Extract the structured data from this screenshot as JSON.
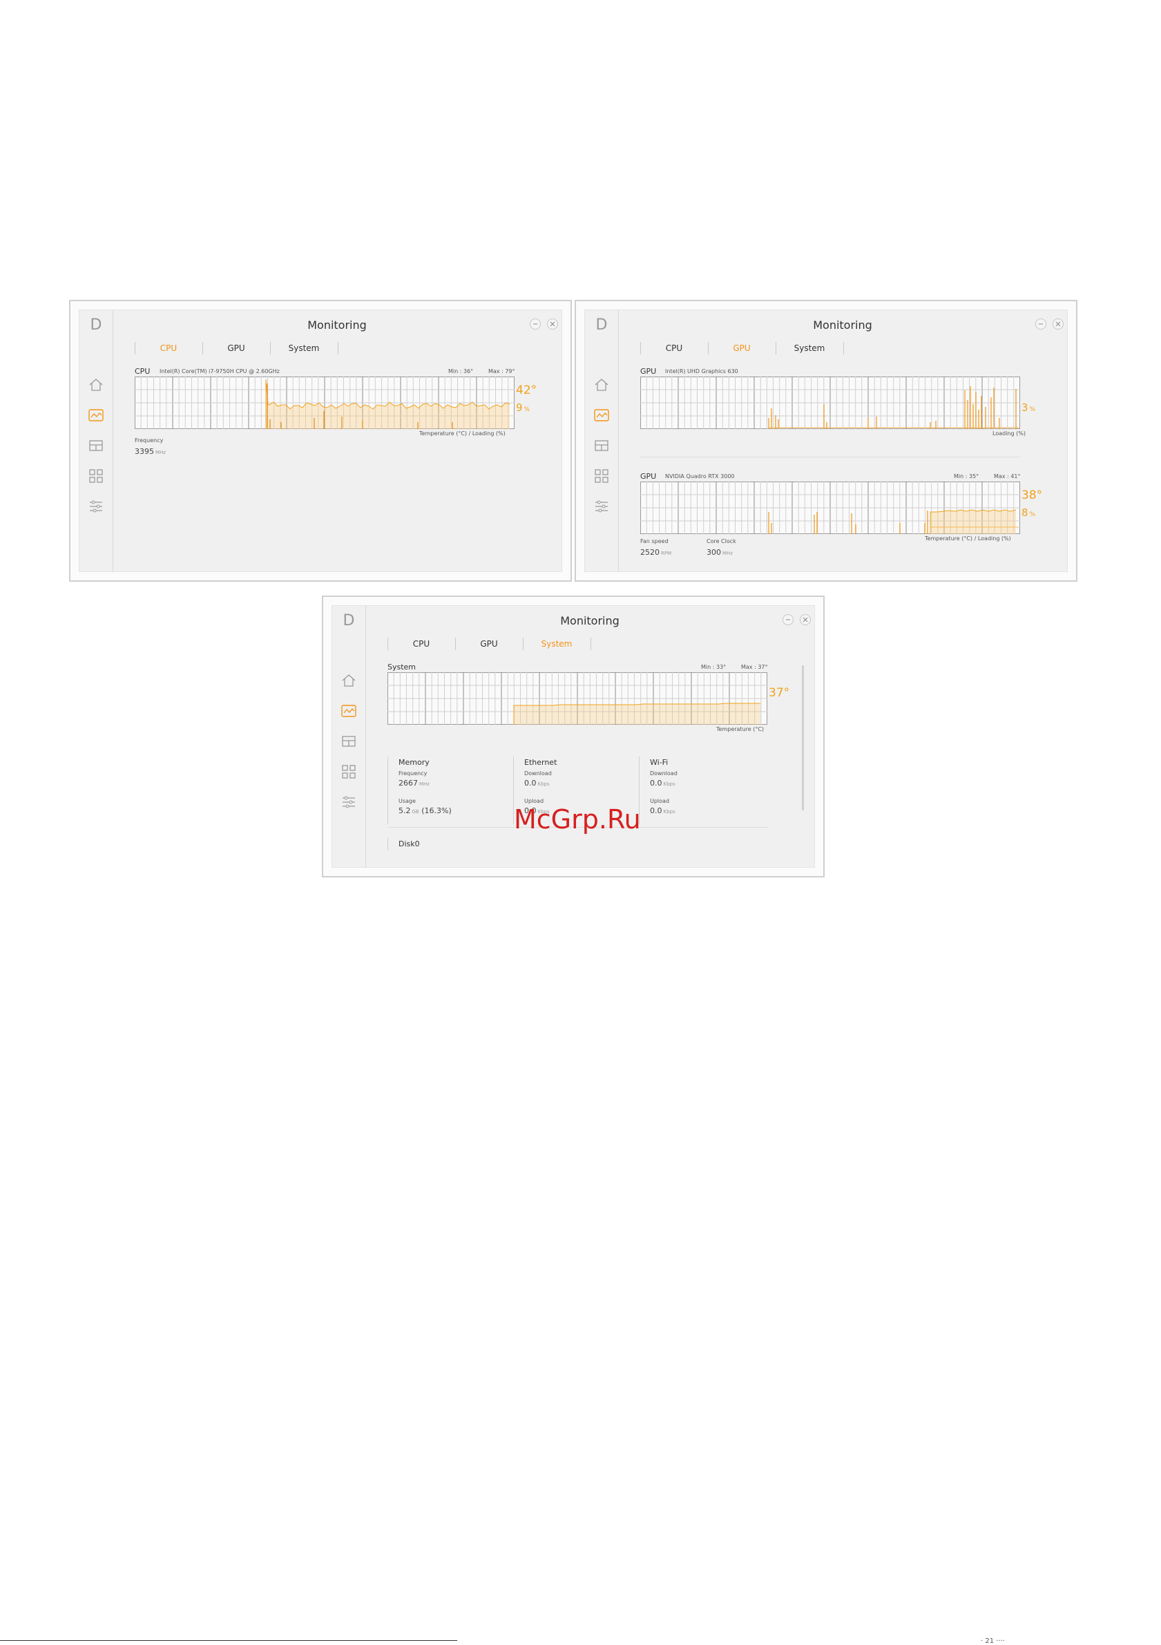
{
  "accent_color": "#f29418",
  "watermark": "McGrp.Ru",
  "footer_text": "· 21 ····",
  "windows": [
    {
      "title": "Monitoring",
      "tabs": [
        "CPU",
        "GPU",
        "System"
      ],
      "active_tab": "CPU",
      "cpu": {
        "label": "CPU",
        "model": "Intel(R) Core(TM) i7-9750H CPU @ 2.60GHz",
        "min": "Min : 36°",
        "max": "Max : 79°",
        "temperature": "42°",
        "loading": "9",
        "loading_unit": "%",
        "axis_caption": "Temperature (°C) / Loading (%)",
        "frequency_label": "Frequency",
        "frequency_value": "3395",
        "frequency_unit": "MHz"
      }
    },
    {
      "title": "Monitoring",
      "tabs": [
        "CPU",
        "GPU",
        "System"
      ],
      "active_tab": "GPU",
      "gpu1": {
        "label": "GPU",
        "model": "Intel(R) UHD Graphics 630",
        "loading": "3",
        "loading_unit": "%",
        "axis_caption": "Loading (%)"
      },
      "gpu2": {
        "label": "GPU",
        "model": "NVIDIA Quadro RTX 3000",
        "min": "Min : 35°",
        "max": "Max : 41°",
        "temperature": "38°",
        "loading": "8",
        "loading_unit": "%",
        "axis_caption": "Temperature (°C) / Loading (%)",
        "fan_label": "Fan speed",
        "fan_value": "2520",
        "fan_unit": "RPM",
        "clock_label": "Core Clock",
        "clock_value": "300",
        "clock_unit": "MHz"
      }
    },
    {
      "title": "Monitoring",
      "tabs": [
        "CPU",
        "GPU",
        "System"
      ],
      "active_tab": "System",
      "system": {
        "label": "System",
        "min": "Min : 33°",
        "max": "Max : 37°",
        "temperature": "37°",
        "axis_caption": "Temperature (°C)",
        "memory": {
          "title": "Memory",
          "frequency_label": "Frequency",
          "frequency_value": "2667",
          "frequency_unit": "MHz",
          "usage_label": "Usage",
          "usage_value": "5.2",
          "usage_unit": "GB",
          "usage_percent": "(16.3%)"
        },
        "ethernet": {
          "title": "Ethernet",
          "download_label": "Download",
          "download_value": "0.0",
          "download_unit": "Kbps",
          "upload_label": "Upload",
          "upload_value": "0.0",
          "upload_unit": "Kbps"
        },
        "wifi": {
          "title": "Wi-Fi",
          "download_label": "Download",
          "download_value": "0.0",
          "download_unit": "Kbps",
          "upload_label": "Upload",
          "upload_value": "0.0",
          "upload_unit": "Kbps"
        },
        "disk": "Disk0"
      }
    }
  ],
  "sidebar_icons": [
    "home-icon",
    "monitoring-icon",
    "layout-icon",
    "apps-icon",
    "settings-sliders-icon"
  ]
}
